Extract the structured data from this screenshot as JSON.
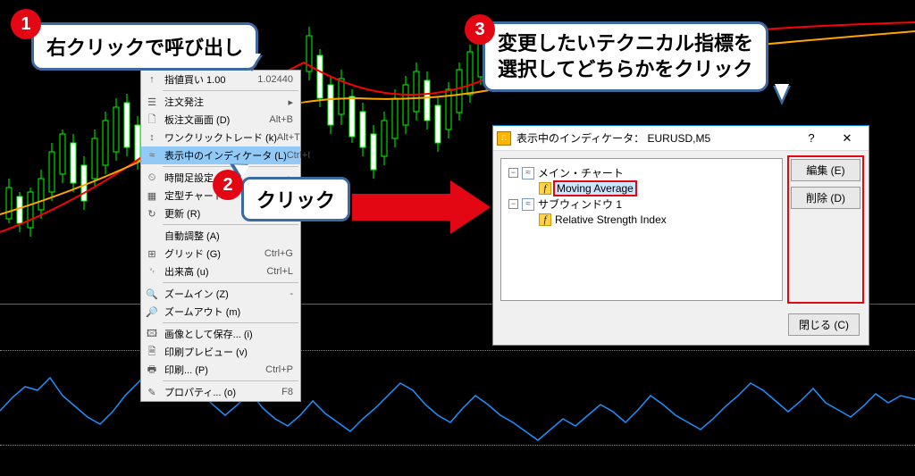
{
  "callouts": {
    "c1": "右クリックで呼び出し",
    "c2": "クリック",
    "c3_line1": "変更したいテクニカル指標を",
    "c3_line2": "選択してどちらかをクリック"
  },
  "badges": {
    "b1": "1",
    "b2": "2",
    "b3": "3"
  },
  "context_menu": [
    {
      "icon": "↑",
      "label": "指値買い 1.00",
      "shortcut": "1.02440",
      "sep": false
    },
    {
      "sep": true
    },
    {
      "icon": "☰",
      "label": "注文発注",
      "shortcut": "▸",
      "sep": false
    },
    {
      "icon": "🗋",
      "label": "板注文画面 (D)",
      "shortcut": "Alt+B",
      "sep": false
    },
    {
      "icon": "↕",
      "label": "ワンクリックトレード (k)",
      "shortcut": "Alt+T",
      "sep": false
    },
    {
      "icon": "≈",
      "label": "表示中のインディケータ (L)",
      "shortcut": "Ctrl+I",
      "sep": false,
      "sel": true
    },
    {
      "sep": true
    },
    {
      "icon": "⏲",
      "label": "時間足設定",
      "shortcut": "▸",
      "sep": false
    },
    {
      "icon": "▦",
      "label": "定型チャート",
      "shortcut": "▸",
      "sep": false
    },
    {
      "icon": "↻",
      "label": "更新 (R)",
      "shortcut": "",
      "sep": false
    },
    {
      "sep": true
    },
    {
      "icon": "",
      "label": "自動調整 (A)",
      "shortcut": "",
      "sep": false
    },
    {
      "icon": "⊞",
      "label": "グリッド (G)",
      "shortcut": "Ctrl+G",
      "sep": false
    },
    {
      "icon": "␋",
      "label": "出来高 (u)",
      "shortcut": "Ctrl+L",
      "sep": false
    },
    {
      "sep": true
    },
    {
      "icon": "🔍",
      "label": "ズームイン (Z)",
      "shortcut": "-",
      "sep": false
    },
    {
      "icon": "🔎",
      "label": "ズームアウト (m)",
      "shortcut": "",
      "sep": false
    },
    {
      "sep": true
    },
    {
      "icon": "🖾",
      "label": "画像として保存... (i)",
      "shortcut": "",
      "sep": false
    },
    {
      "icon": "🗎",
      "label": "印刷プレビュー (v)",
      "shortcut": "",
      "sep": false
    },
    {
      "icon": "🖶",
      "label": "印刷... (P)",
      "shortcut": "Ctrl+P",
      "sep": false
    },
    {
      "sep": true
    },
    {
      "icon": "✎",
      "label": "プロパティ... (o)",
      "shortcut": "F8",
      "sep": false
    }
  ],
  "dialog": {
    "title": "表示中のインディケータ： EURUSD,M5",
    "help": "?",
    "close_x": "✕",
    "tree": {
      "root1": "メイン・チャート",
      "root1_child": "Moving Average",
      "root2": "サブウィンドウ 1",
      "root2_child": "Relative Strength Index"
    },
    "buttons": {
      "edit": "編集 (E)",
      "delete": "削除 (D)",
      "close": "閉じる (C)"
    }
  },
  "chart_data": {
    "type": "candlestick+indicator",
    "symbol": "EURUSD",
    "timeframe": "M5",
    "ma_red_color": "#ff0000",
    "ma_orange_color": "#ffa500",
    "rsi_color": "#1e90ff",
    "rsi_values_est": [
      45,
      52,
      60,
      58,
      65,
      55,
      48,
      42,
      38,
      45,
      55,
      62,
      70,
      68,
      72,
      65,
      58,
      50,
      44,
      50,
      58,
      48,
      42,
      38,
      44,
      52,
      45,
      40,
      35,
      42,
      48,
      55,
      62,
      58,
      50,
      44,
      40,
      48,
      55,
      50,
      44,
      40,
      35,
      30,
      36,
      42,
      38,
      44,
      50,
      45,
      40,
      48,
      55,
      50,
      44,
      40,
      36,
      42,
      48,
      55,
      62,
      58,
      52,
      46,
      52,
      58,
      50,
      46,
      42,
      48,
      55,
      50
    ],
    "candles_est": [
      {
        "o": 1.026,
        "h": 1.0268,
        "l": 1.0255,
        "c": 1.0262
      },
      {
        "o": 1.0262,
        "h": 1.0265,
        "l": 1.0248,
        "c": 1.025
      },
      {
        "o": 1.025,
        "h": 1.0258,
        "l": 1.0245,
        "c": 1.0256
      },
      {
        "o": 1.0256,
        "h": 1.029,
        "l": 1.0254,
        "c": 1.0285
      }
    ],
    "price_visible": "1.02440"
  }
}
